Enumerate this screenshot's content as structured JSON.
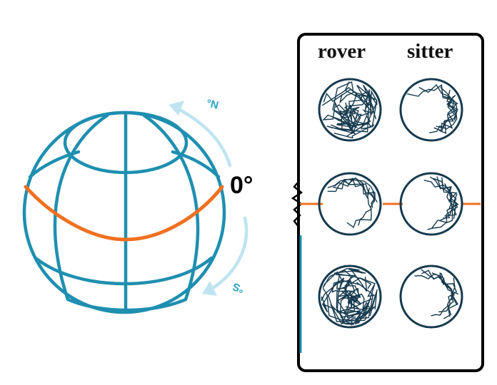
{
  "angle_label": "0°",
  "direction_labels": {
    "north": "°N",
    "south": "°S"
  },
  "columns": {
    "left": "rover",
    "right": "sitter"
  },
  "arena_rows": [
    {
      "rover": "dense",
      "sitter": "sparse"
    },
    {
      "rover": "sparse",
      "sitter": "sparse"
    },
    {
      "rover": "dense",
      "sitter": "sparse"
    }
  ],
  "colors": {
    "globe": "#1f8fb0",
    "equator": "#f07020",
    "arrow": "#bfe4f0",
    "trajectory": "#163a4e",
    "frame": "#000000"
  }
}
